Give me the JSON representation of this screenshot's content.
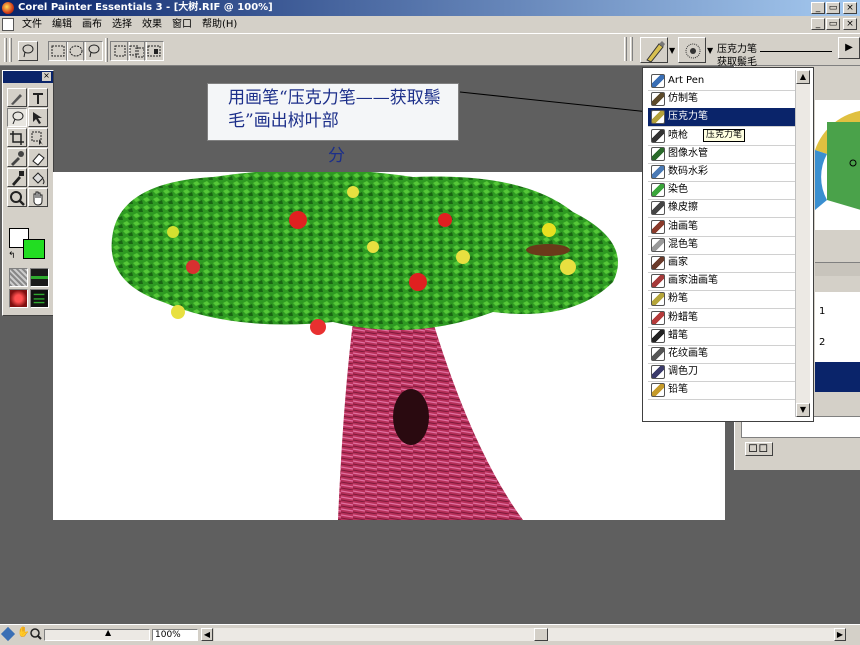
{
  "window": {
    "title": "Corel Painter Essentials 3 - [大树.RIF @ 100%]",
    "min_glyph": "_",
    "restore_glyph": "▭",
    "close_glyph": "×"
  },
  "menu": [
    {
      "label": "文件",
      "name": "menu-file"
    },
    {
      "label": "编辑",
      "name": "menu-edit"
    },
    {
      "label": "画布",
      "name": "menu-canvas"
    },
    {
      "label": "选择",
      "name": "menu-select"
    },
    {
      "label": "效果",
      "name": "menu-effects"
    },
    {
      "label": "窗口",
      "name": "menu-window"
    },
    {
      "label": "帮助(H)",
      "name": "menu-help"
    }
  ],
  "callout": {
    "text": "用画笔“压克力笔——获取鬃毛”画出树叶部",
    "tail": "分"
  },
  "brush_selector": {
    "category_label": "压克力笔",
    "variant_label": "获取鬃毛",
    "arrow": "▶"
  },
  "brush_list": {
    "items": [
      {
        "label": "Art Pen",
        "icon": "art-pen-icon",
        "color": "#3a6fb5"
      },
      {
        "label": "仿制笔",
        "icon": "cloner-icon",
        "color": "#5c4a2a"
      },
      {
        "label": "压克力笔",
        "icon": "acrylic-icon",
        "color": "#b5a23a",
        "selected": true
      },
      {
        "label": "喷枪",
        "icon": "airbrush-icon",
        "color": "#333333"
      },
      {
        "label": "图像水管",
        "icon": "image-hose-icon",
        "color": "#2a6a2a"
      },
      {
        "label": "数码水彩",
        "icon": "digital-watercolor-icon",
        "color": "#4a7ab5"
      },
      {
        "label": "染色",
        "icon": "tinting-icon",
        "color": "#3aa53a"
      },
      {
        "label": "橡皮擦",
        "icon": "eraser-icon",
        "color": "#444444"
      },
      {
        "label": "油画笔",
        "icon": "oil-icon",
        "color": "#8a3a2a"
      },
      {
        "label": "混色笔",
        "icon": "blender-icon",
        "color": "#9a9a9a"
      },
      {
        "label": "画家",
        "icon": "artists-icon",
        "color": "#6a3a2a"
      },
      {
        "label": "画家油画笔",
        "icon": "artists-oils-icon",
        "color": "#a53a3a"
      },
      {
        "label": "粉笔",
        "icon": "chalk-icon",
        "color": "#b5a53a"
      },
      {
        "label": "粉蜡笔",
        "icon": "pastel-icon",
        "color": "#b53a3a"
      },
      {
        "label": "蜡笔",
        "icon": "crayon-icon",
        "color": "#222222"
      },
      {
        "label": "花纹画笔",
        "icon": "pattern-pen-icon",
        "color": "#555555"
      },
      {
        "label": "调色刀",
        "icon": "palette-knife-icon",
        "color": "#3a3a6a"
      },
      {
        "label": "铅笔",
        "icon": "pencil-icon",
        "color": "#c59a2a"
      }
    ],
    "scroll_up": "▲",
    "scroll_down": "▼"
  },
  "tooltip": "压克力笔",
  "right_panel": {
    "list_rows": [
      "1",
      "2"
    ]
  },
  "status": {
    "zoom": "100%"
  },
  "colors": {
    "main_color": "#ffffff",
    "additional_color": "#22dd22",
    "selection": "#0a246a",
    "callout_text": "#1c2f8a"
  }
}
